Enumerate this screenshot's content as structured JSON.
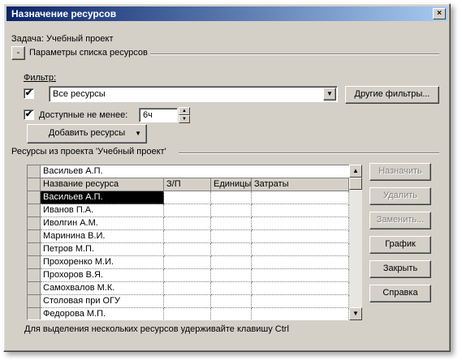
{
  "window": {
    "title": "Назначение ресурсов",
    "close_glyph": "×"
  },
  "task_label": "Задача: Учебный проект",
  "options": {
    "toggle": "-",
    "section_label": "Параметры списка ресурсов"
  },
  "filter": {
    "label": "Фильтр:",
    "checked": true,
    "value": "Все ресурсы",
    "other_filters_button": "Другие фильтры..."
  },
  "available": {
    "checked": true,
    "label": "Доступные не менее:",
    "value": "6ч"
  },
  "add_resources_button": "Добавить ресурсы",
  "resources_section_label": "Ресурсы из проекта 'Учебный проект'",
  "grid": {
    "edit_value": "Васильев А.П.",
    "columns": [
      "Название ресурса",
      "З/П",
      "Единицы",
      "Затраты"
    ],
    "rows": [
      "Васильев А.П.",
      "Иванов П.А.",
      "Иволгин А.М.",
      "Маринина В.И.",
      "Петров М.П.",
      "Прохоренко М.И.",
      "Прохоров В.Я.",
      "Самохвалов М.К.",
      "Столовая при ОГУ",
      "Федорова М.П."
    ],
    "selected_row": 0
  },
  "buttons": {
    "assign": "Назначить",
    "remove": "Удалить",
    "replace": "Заменить...",
    "graph": "График",
    "close": "Закрыть",
    "help": "Справка"
  },
  "hint": "Для выделения нескольких ресурсов удерживайте клавишу Ctrl",
  "colors": {
    "title_start": "#0a246a",
    "title_end": "#a6caf0",
    "face": "#d4d0c8"
  }
}
